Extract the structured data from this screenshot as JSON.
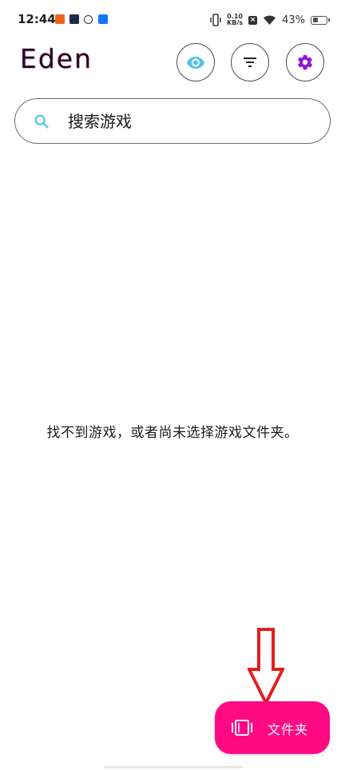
{
  "status_bar": {
    "time": "12:44",
    "net_speed_value": "0.10",
    "net_speed_unit": "KB/s",
    "battery_percent": "43%",
    "battery_level": 0.43,
    "notification_icons": [
      "app-notification-icon",
      "play-notification-icon",
      "link-notification-icon",
      "alipay-notification-icon"
    ]
  },
  "header": {
    "title": "Eden",
    "buttons": [
      {
        "name": "eye-icon",
        "color": "#4fc3e8"
      },
      {
        "name": "filter-icon",
        "color": "#222222"
      },
      {
        "name": "gear-icon",
        "color": "#8b1ad6"
      }
    ]
  },
  "search": {
    "placeholder": "搜索游戏",
    "icon_color": "#4fc3e8"
  },
  "main": {
    "empty_message": "找不到游戏，或者尚未选择游戏文件夹。"
  },
  "fab": {
    "label": "文件夹",
    "color": "#ff0a84",
    "icon": "folder-icon"
  },
  "annotation": {
    "arrow_color": "#e02020"
  }
}
